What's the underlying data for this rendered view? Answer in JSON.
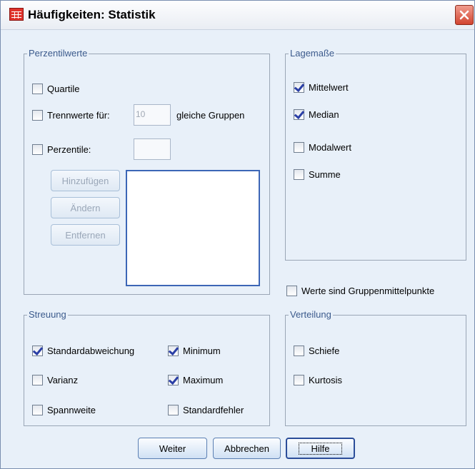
{
  "window": {
    "title": "Häufigkeiten: Statistik",
    "close_icon": "close-icon"
  },
  "perzentilwerte": {
    "label": "Perzentilwerte",
    "quartile": {
      "label": "Quartile",
      "checked": false
    },
    "trennwerte": {
      "label": "Trennwerte für:",
      "value": "10",
      "suffix": "gleiche Gruppen",
      "checked": false
    },
    "perzentile": {
      "label": "Perzentile:",
      "value": "",
      "checked": false
    },
    "buttons": {
      "add": "Hinzufügen",
      "change": "Ändern",
      "remove": "Entfernen"
    }
  },
  "lagemasse": {
    "label": "Lagemaße",
    "items": [
      {
        "label": "Mittelwert",
        "checked": true
      },
      {
        "label": "Median",
        "checked": true
      },
      {
        "label": "Modalwert",
        "checked": false
      },
      {
        "label": "Summe",
        "checked": false
      }
    ]
  },
  "gruppenmittelpunkte": {
    "label": "Werte sind Gruppenmittelpunkte",
    "checked": false
  },
  "streuung": {
    "label": "Streuung",
    "items": [
      {
        "label": "Standardabweichung",
        "checked": true
      },
      {
        "label": "Minimum",
        "checked": true
      },
      {
        "label": "Varianz",
        "checked": false
      },
      {
        "label": "Maximum",
        "checked": true
      },
      {
        "label": "Spannweite",
        "checked": false
      },
      {
        "label": "Standardfehler",
        "checked": false
      }
    ]
  },
  "verteilung": {
    "label": "Verteilung",
    "items": [
      {
        "label": "Schiefe",
        "checked": false
      },
      {
        "label": "Kurtosis",
        "checked": false
      }
    ]
  },
  "footer": {
    "continue": "Weiter",
    "cancel": "Abbrechen",
    "help": "Hilfe"
  }
}
